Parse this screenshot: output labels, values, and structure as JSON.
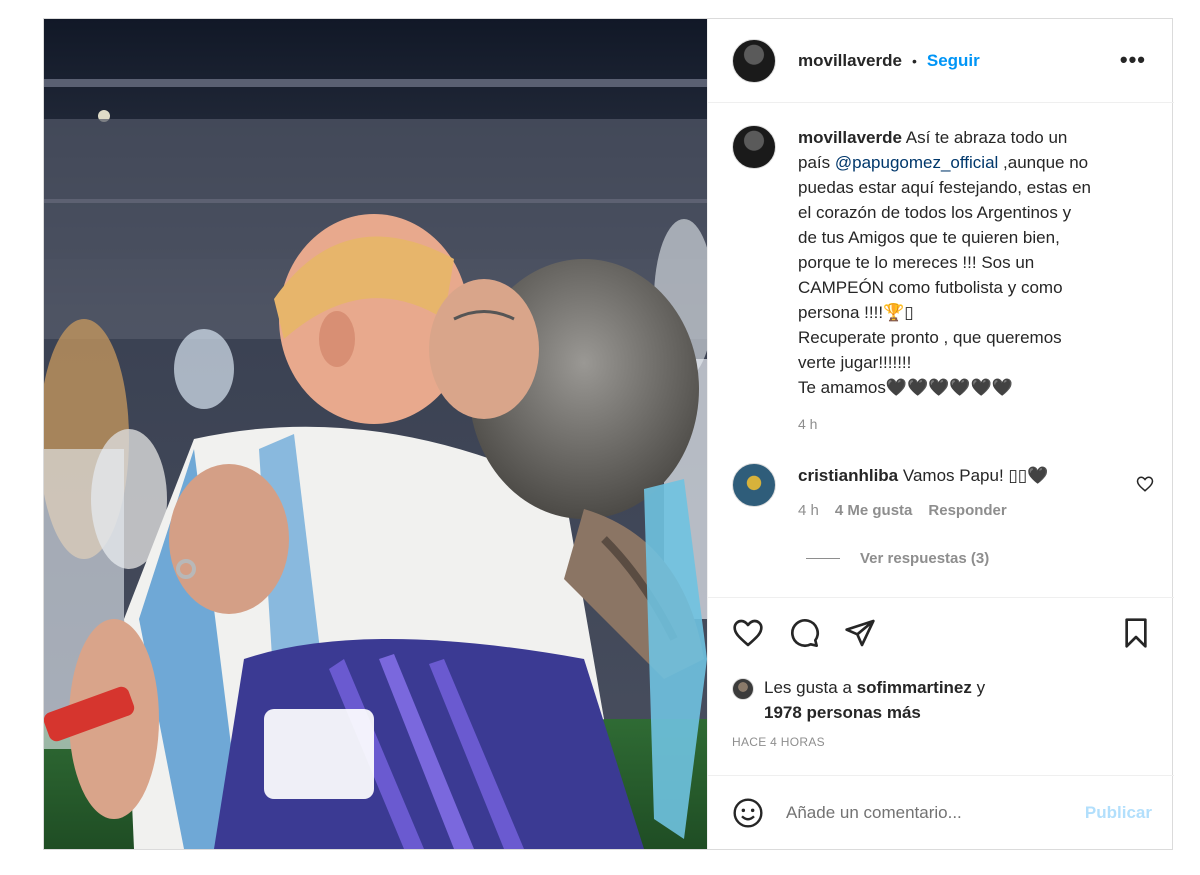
{
  "post": {
    "username": "movillaverde",
    "separator": "•",
    "follow_label": "Seguir",
    "more_label": "•••",
    "caption": {
      "username": "movillaverde",
      "lines": [
        "Así te abraza todo un",
        "país",
        "@papugomez_official",
        ",aunque no",
        "puedas estar aquí festejando, estas en",
        "el corazón de todos los Argentinos y",
        "de tus Amigos que te quieren bien,",
        "porque te lo mereces !!! Sos un",
        "CAMPEÓN como futbolista y como",
        "persona !!!!🏆▯",
        "Recuperate pronto , que queremos",
        "verte jugar!!!!!!!",
        "Te amamos🖤🖤🖤🖤🖤🖤"
      ],
      "time": "4 h"
    },
    "comment": {
      "username": "cristianhliba",
      "text": "Vamos Papu! ▯▯🖤",
      "time": "4 h",
      "likes": "4 Me gusta",
      "reply_label": "Responder",
      "view_replies": "Ver respuestas (3)"
    },
    "likes": {
      "prefix": "Les gusta a",
      "user": "sofimmartinez",
      "connector": "y",
      "others": "1978 personas más"
    },
    "age": "HACE 4 HORAS",
    "composer": {
      "placeholder": "Añade un comentario...",
      "publish_label": "Publicar"
    }
  },
  "colors": {
    "link_blue": "#0095f6",
    "mention_blue": "#00376b",
    "muted": "#8e8e8e",
    "publish_disabled": "#b2dffc"
  },
  "icons": [
    "heart-icon",
    "comment-icon",
    "share-icon",
    "bookmark-icon",
    "emoji-icon",
    "more-icon"
  ]
}
